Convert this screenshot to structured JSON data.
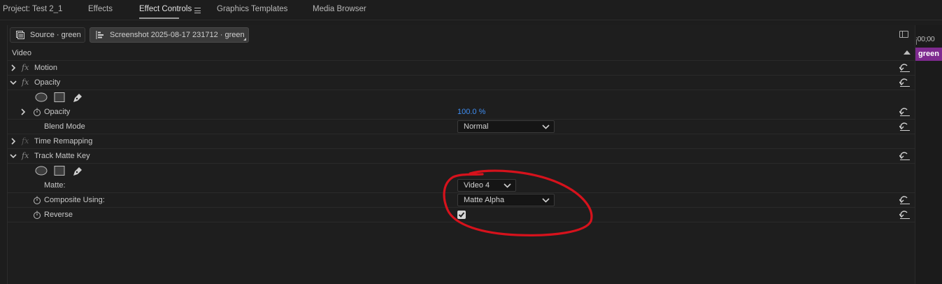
{
  "tabs": [
    {
      "label": "Project: Test 2_1",
      "active": false
    },
    {
      "label": "Effects",
      "active": false
    },
    {
      "label": "Effect Controls",
      "active": true
    },
    {
      "label": "Graphics Templates",
      "active": false
    },
    {
      "label": "Media Browser",
      "active": false
    }
  ],
  "source_bar": {
    "source_label": "Source · green",
    "sequence_label": "Screenshot 2025-08-17 231712 · green"
  },
  "timeline": {
    "timecode": ":00;00",
    "clip_label": "green",
    "clip_color": "#7e2a8f"
  },
  "effects": {
    "section_label": "Video",
    "motion": {
      "label": "Motion"
    },
    "opacity": {
      "label": "Opacity",
      "property_label": "Opacity",
      "property_value": "100.0 %",
      "blend_mode_label": "Blend Mode",
      "blend_mode_value": "Normal"
    },
    "time_remapping": {
      "label": "Time Remapping"
    },
    "track_matte_key": {
      "label": "Track Matte Key",
      "matte_label": "Matte:",
      "matte_value": "Video 4",
      "composite_label": "Composite Using:",
      "composite_value": "Matte Alpha",
      "reverse_label": "Reverse",
      "reverse_checked": true
    }
  },
  "colors": {
    "value_blue": "#3f8ef3",
    "annotation_red": "#d6121c"
  },
  "fx_glyph": "fx"
}
